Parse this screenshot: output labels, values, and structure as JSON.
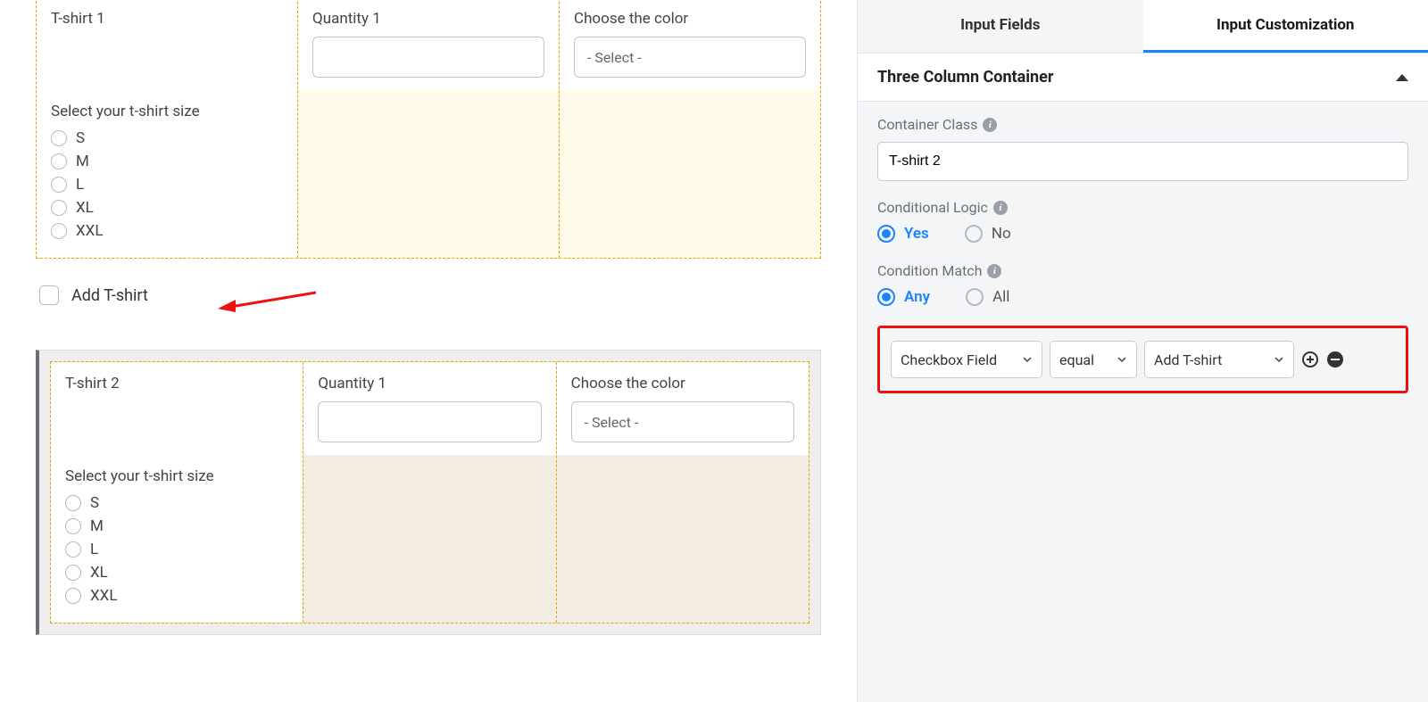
{
  "form": {
    "block1": {
      "title": "T-shirt 1",
      "sizeLabel": "Select your t-shirt size",
      "sizes": [
        "S",
        "M",
        "L",
        "XL",
        "XXL"
      ],
      "qtyLabel": "Quantity 1",
      "colorLabel": "Choose the color",
      "colorPlaceholder": "- Select -"
    },
    "addCheckboxLabel": "Add T-shirt",
    "block2": {
      "title": "T-shirt 2",
      "sizeLabel": "Select your t-shirt size",
      "sizes": [
        "S",
        "M",
        "L",
        "XL",
        "XXL"
      ],
      "qtyLabel": "Quantity 1",
      "colorLabel": "Choose the color",
      "colorPlaceholder": "- Select -"
    }
  },
  "panel": {
    "tabs": {
      "fields": "Input Fields",
      "custom": "Input Customization"
    },
    "sectionTitle": "Three Column Container",
    "containerClass": {
      "label": "Container Class",
      "value": "T-shirt 2"
    },
    "conditionalLogic": {
      "label": "Conditional Logic",
      "yes": "Yes",
      "no": "No"
    },
    "conditionMatch": {
      "label": "Condition Match",
      "any": "Any",
      "all": "All"
    },
    "rule": {
      "field": "Checkbox Field",
      "op": "equal",
      "value": "Add T-shirt"
    }
  }
}
